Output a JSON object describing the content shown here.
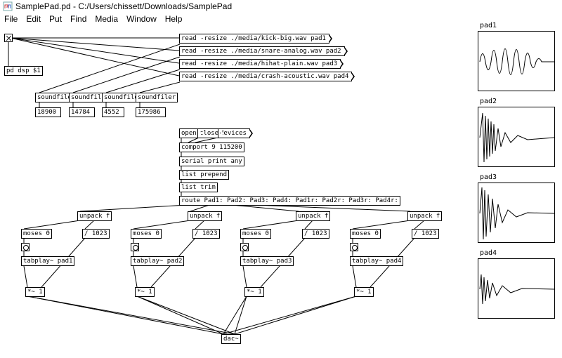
{
  "window": {
    "title": "SamplePad.pd  - C:/Users/chissett/Downloads/SamplePad"
  },
  "menu": {
    "file": "File",
    "edit": "Edit",
    "put": "Put",
    "find": "Find",
    "media": "Media",
    "window": "Window",
    "help": "Help"
  },
  "read_msgs": {
    "r1": "read -resize ./media/kick-big.wav pad1",
    "r2": "read -resize ./media/snare-analog.wav pad2",
    "r3": "read -resize ./media/hihat-plain.wav pad3",
    "r4": "read -resize ./media/crash-acoustic.wav pad4"
  },
  "objs": {
    "pd_dsp": "pd dsp $1",
    "sf1": "soundfiler",
    "sf2": "soundfiler",
    "sf3": "soundfiler",
    "sf4": "soundfiler",
    "n1": "18900",
    "n2": "14784",
    "n3": "4552",
    "n4": "175986",
    "open": "open",
    "close": "close",
    "devices": "devices",
    "comport": "comport 9 115200",
    "serial": "serial print any",
    "lprepend": "list prepend",
    "ltrim": "list trim",
    "route": "route Pad1: Pad2: Pad3: Pad4: Pad1r: Pad2r: Pad3r: Pad4r:",
    "unpack": "unpack f",
    "moses": "moses 0",
    "div1023": "/ 1023",
    "tp1": "tabplay~ pad1",
    "tp2": "tabplay~ pad2",
    "tp3": "tabplay~ pad3",
    "tp4": "tabplay~ pad4",
    "mul": "*~ 1",
    "dac": "dac~"
  },
  "arrays": {
    "a1": "pad1",
    "a2": "pad2",
    "a3": "pad3",
    "a4": "pad4"
  }
}
